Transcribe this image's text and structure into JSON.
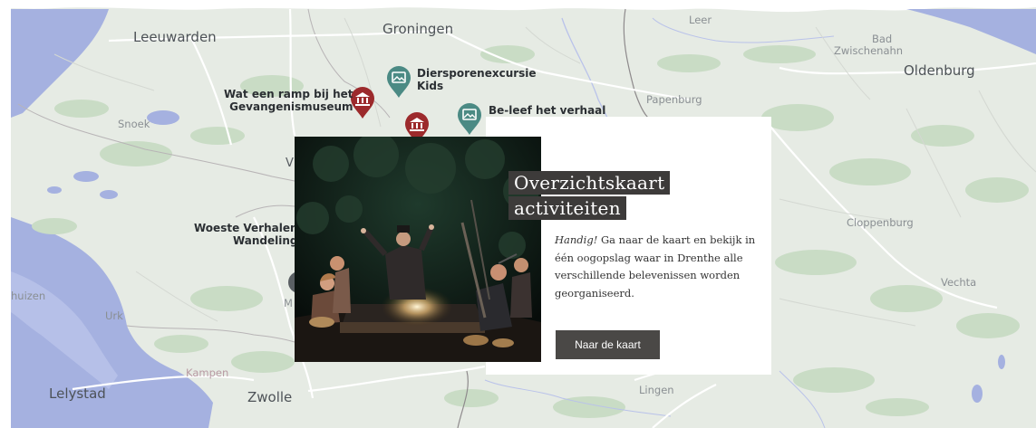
{
  "map": {
    "cities": [
      {
        "name": "Leeuwarden"
      },
      {
        "name": "Groningen"
      },
      {
        "name": "Leer"
      },
      {
        "name": "Bad"
      },
      {
        "name": "Zwischenahn"
      },
      {
        "name": "Oldenburg"
      },
      {
        "name": "Snoek"
      },
      {
        "name": "Papenburg"
      },
      {
        "name": "V"
      },
      {
        "name": "Cloppenburg"
      },
      {
        "name": "Vechta"
      },
      {
        "name": "huizen"
      },
      {
        "name": "Urk"
      },
      {
        "name": "M"
      },
      {
        "name": "Kampen"
      },
      {
        "name": "Lelystad"
      },
      {
        "name": "Zwolle"
      },
      {
        "name": "Lingen"
      }
    ],
    "pins": [
      {
        "label_lines": [
          "Diersporenexcursie",
          "Kids"
        ],
        "icon": "map-photo-icon",
        "color": "#4b8a84"
      },
      {
        "label_lines": [
          "Wat een ramp bij het",
          "Gevangenismuseum"
        ],
        "icon": "museum-icon",
        "color": "#9c2a2c"
      },
      {
        "label_lines": [],
        "icon": "museum-icon",
        "color": "#9c2a2c"
      },
      {
        "label_lines": [
          "Be-leef het verhaal"
        ],
        "icon": "map-photo-icon",
        "color": "#4b8a84"
      }
    ],
    "side_labels": [
      {
        "lines": [
          "Woeste Verhalen",
          "Wandeling"
        ]
      }
    ],
    "colors": {
      "land": "#e6ebe4",
      "water": "#a5b1e0",
      "green": "#c9dcc5",
      "border": "#8e8a8c"
    }
  },
  "card": {
    "title_lines": [
      "Overzichtskaart",
      "activiteiten"
    ],
    "description_em": "Handig!",
    "description_rest": " Ga naar de kaart en bekijk in één oogopslag waar in Drenthe alle verschillende belevenissen worden georganiseerd.",
    "button_label": "Naar de kaart",
    "photo_icon": "storytelling-photo"
  }
}
